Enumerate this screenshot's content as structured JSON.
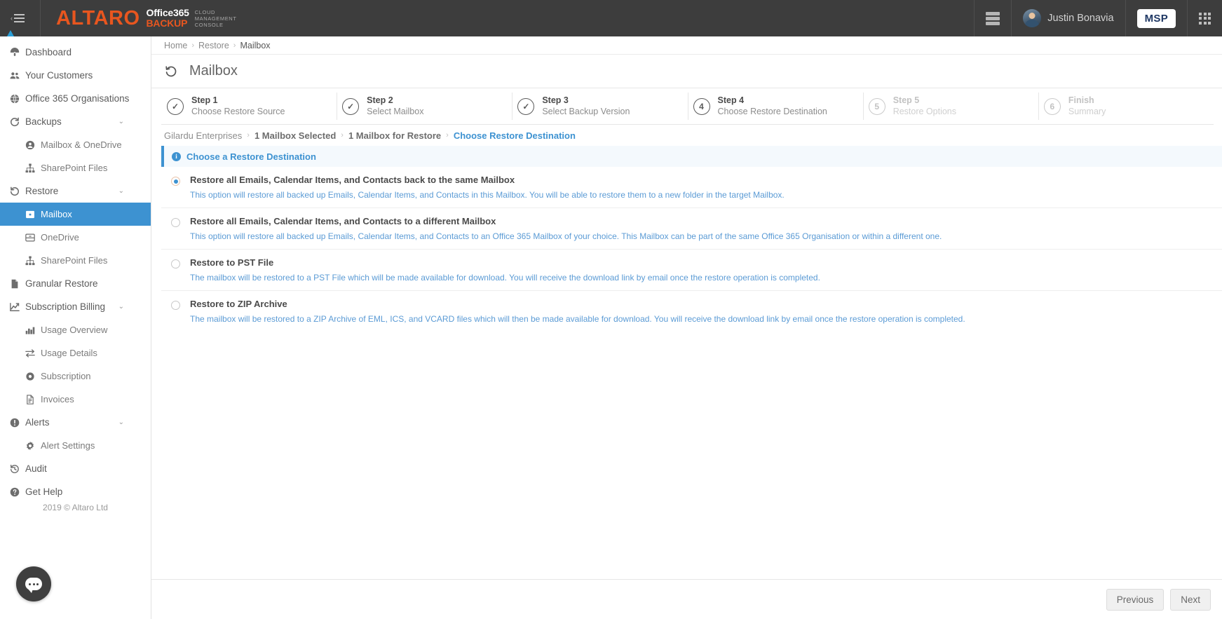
{
  "topbar": {
    "menu_toggle_icon": "hamburger-collapse-icon",
    "logo": {
      "brand": "ALTARO",
      "product_line1": "Office365",
      "product_line2": "BACKUP",
      "tag_line1": "CLOUD",
      "tag_line2": "MANAGEMENT",
      "tag_line3": "CONSOLE"
    },
    "servers_icon": "server-stack-icon",
    "username": "Justin Bonavia",
    "msp_badge": "MSP",
    "apps_icon": "app-grid-icon"
  },
  "sidebar": {
    "items": [
      {
        "label": "Dashboard",
        "icon": "dashboard-icon",
        "level": "top",
        "active": false,
        "chevron": false
      },
      {
        "label": "Your Customers",
        "icon": "customers-icon",
        "level": "top",
        "active": false,
        "chevron": false
      },
      {
        "label": "Office 365 Organisations",
        "icon": "globe-icon",
        "level": "top",
        "active": false,
        "chevron": false
      },
      {
        "label": "Backups",
        "icon": "refresh-icon",
        "level": "top",
        "active": false,
        "chevron": true
      },
      {
        "label": "Mailbox & OneDrive",
        "icon": "user-circle-icon",
        "level": "sub",
        "active": false,
        "chevron": false
      },
      {
        "label": "SharePoint Files",
        "icon": "sitemap-icon",
        "level": "sub",
        "active": false,
        "chevron": false
      },
      {
        "label": "Restore",
        "icon": "restore-icon",
        "level": "top",
        "active": false,
        "chevron": true
      },
      {
        "label": "Mailbox",
        "icon": "mailbox-icon",
        "level": "sub",
        "active": true,
        "chevron": false
      },
      {
        "label": "OneDrive",
        "icon": "onedrive-icon",
        "level": "sub",
        "active": false,
        "chevron": false
      },
      {
        "label": "SharePoint Files",
        "icon": "sitemap-icon",
        "level": "sub",
        "active": false,
        "chevron": false
      },
      {
        "label": "Granular Restore",
        "icon": "document-icon",
        "level": "top",
        "active": false,
        "chevron": false
      },
      {
        "label": "Subscription Billing",
        "icon": "chart-line-icon",
        "level": "top",
        "active": false,
        "chevron": true
      },
      {
        "label": "Usage Overview",
        "icon": "bar-chart-icon",
        "level": "sub",
        "active": false,
        "chevron": false
      },
      {
        "label": "Usage Details",
        "icon": "exchange-arrows-icon",
        "level": "sub",
        "active": false,
        "chevron": false
      },
      {
        "label": "Subscription",
        "icon": "gear-burst-icon",
        "level": "sub",
        "active": false,
        "chevron": false
      },
      {
        "label": "Invoices",
        "icon": "invoice-icon",
        "level": "sub",
        "active": false,
        "chevron": false
      },
      {
        "label": "Alerts",
        "icon": "alert-icon",
        "level": "top",
        "active": false,
        "chevron": true
      },
      {
        "label": "Alert Settings",
        "icon": "gear-icon",
        "level": "sub",
        "active": false,
        "chevron": false
      },
      {
        "label": "Audit",
        "icon": "history-icon",
        "level": "top",
        "active": false,
        "chevron": false
      },
      {
        "label": "Get Help",
        "icon": "question-circle-icon",
        "level": "top",
        "active": false,
        "chevron": false
      }
    ],
    "copyright": "2019 © Altaro Ltd",
    "chat_icon": "chat-bubble-icon"
  },
  "breadcrumb": {
    "items": [
      "Home",
      "Restore",
      "Mailbox"
    ],
    "separator": "›"
  },
  "page": {
    "title": "Mailbox",
    "title_icon": "restore-arrow-icon"
  },
  "stepper": {
    "steps": [
      {
        "name": "Step 1",
        "desc": "Choose Restore Source",
        "state": "done",
        "badge": "✓"
      },
      {
        "name": "Step 2",
        "desc": "Select Mailbox",
        "state": "done",
        "badge": "✓"
      },
      {
        "name": "Step 3",
        "desc": "Select Backup Version",
        "state": "done",
        "badge": "✓"
      },
      {
        "name": "Step 4",
        "desc": "Choose Restore Destination",
        "state": "current",
        "badge": "4"
      },
      {
        "name": "Step 5",
        "desc": "Restore Options",
        "state": "pending",
        "badge": "5"
      },
      {
        "name": "Finish",
        "desc": "Summary",
        "state": "pending",
        "badge": "6"
      }
    ]
  },
  "subcrumb": {
    "items": [
      "Gilardu Enterprises",
      "1 Mailbox Selected",
      "1 Mailbox for Restore"
    ],
    "current": "Choose Restore Destination",
    "separator": "›"
  },
  "infobar": {
    "icon": "info-icon",
    "text": "Choose a Restore Destination"
  },
  "options": [
    {
      "selected": true,
      "title": "Restore all Emails, Calendar Items, and Contacts back to the same Mailbox",
      "desc": "This option will restore all backed up Emails, Calendar Items, and Contacts in this Mailbox. You will be able to restore them to a new folder in the target Mailbox."
    },
    {
      "selected": false,
      "title": "Restore all Emails, Calendar Items, and Contacts to a different Mailbox",
      "desc": "This option will restore all backed up Emails, Calendar Items, and Contacts to an Office 365 Mailbox of your choice. This Mailbox can be part of the same Office 365 Organisation or within a different one."
    },
    {
      "selected": false,
      "title": "Restore to PST File",
      "desc": "The mailbox will be restored to a PST File which will be made available for download. You will receive the download link by email once the restore operation is completed."
    },
    {
      "selected": false,
      "title": "Restore to ZIP Archive",
      "desc": "The mailbox will be restored to a ZIP Archive of EML, ICS, and VCARD files which will then be made available for download. You will receive the download link by email once the restore operation is completed."
    }
  ],
  "footer": {
    "previous_label": "Previous",
    "next_label": "Next"
  },
  "colors": {
    "accent_blue": "#3d92d1",
    "brand_orange": "#e8561f",
    "topbar_bg": "#3d3d3d",
    "link_blue": "#5b9bd5"
  }
}
